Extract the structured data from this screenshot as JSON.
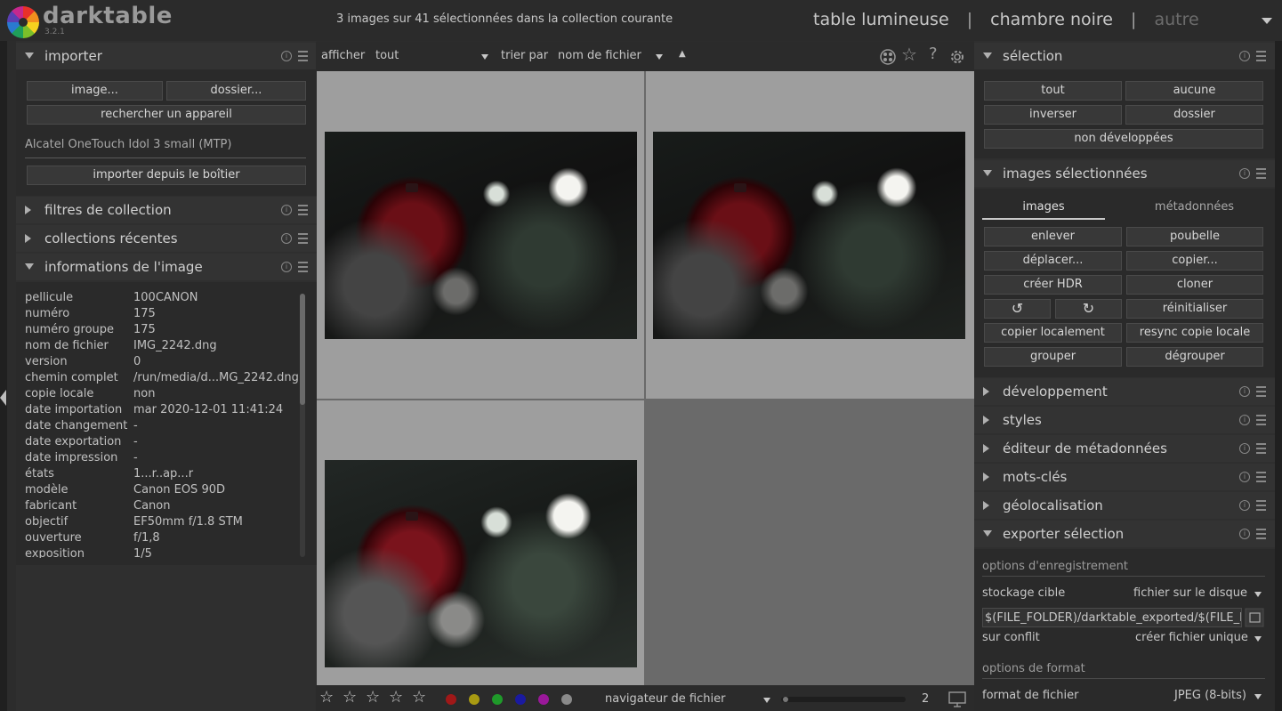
{
  "header": {
    "app_name": "darktable",
    "version": "3.2.1",
    "status": "3 images sur 41 sélectionnées dans la collection courante",
    "views": [
      "table lumineuse",
      "chambre noire",
      "autre"
    ],
    "separator": "|"
  },
  "left": {
    "importer": {
      "title": "importer",
      "buttons": {
        "image": "image...",
        "folder": "dossier...",
        "scan": "rechercher un appareil"
      },
      "device": "Alcatel OneTouch Idol 3 small (MTP)",
      "import_device": "importer depuis le boîtier"
    },
    "collection_filters": "filtres de collection",
    "recent_collections": "collections récentes",
    "image_info": {
      "title": "informations de l'image",
      "rows": [
        {
          "k": "pellicule",
          "v": "100CANON"
        },
        {
          "k": "numéro",
          "v": "175"
        },
        {
          "k": "numéro groupe",
          "v": "175"
        },
        {
          "k": "nom de fichier",
          "v": "IMG_2242.dng"
        },
        {
          "k": "version",
          "v": "0"
        },
        {
          "k": "chemin complet",
          "v": "/run/media/d...MG_2242.dng"
        },
        {
          "k": "copie locale",
          "v": "non"
        },
        {
          "k": "date importation",
          "v": "mar 2020-12-01 11:41:24"
        },
        {
          "k": "date changement",
          "v": "-"
        },
        {
          "k": "date exportation",
          "v": "-"
        },
        {
          "k": "date impression",
          "v": "-"
        },
        {
          "k": "états",
          "v": "1...r..ap...r"
        },
        {
          "k": "modèle",
          "v": "Canon EOS 90D"
        },
        {
          "k": "fabricant",
          "v": "Canon"
        },
        {
          "k": "objectif",
          "v": "EF50mm f/1.8 STM"
        },
        {
          "k": "ouverture",
          "v": "f/1,8"
        },
        {
          "k": "exposition",
          "v": "1/5"
        }
      ]
    }
  },
  "toolbar": {
    "show_label": "afficher",
    "show_value": "tout",
    "sort_label": "trier par",
    "sort_value": "nom de fichier",
    "sort_dir": "▲"
  },
  "bottombar": {
    "stars": [
      "☆",
      "☆",
      "☆",
      "☆",
      "☆"
    ],
    "color_labels": [
      "#a01818",
      "#a89a12",
      "#1f9a2a",
      "#1a1aa0",
      "#9a189a",
      "#8a8a8a"
    ],
    "layout": "navigateur de fichier",
    "zoom": "2"
  },
  "right": {
    "selection": {
      "title": "sélection",
      "buttons": [
        "tout",
        "aucune",
        "inverser",
        "dossier",
        "non développées"
      ]
    },
    "selected_images": {
      "title": "images sélectionnées",
      "tabs": [
        "images",
        "métadonnées"
      ],
      "buttons": [
        "enlever",
        "poubelle",
        "déplacer...",
        "copier...",
        "créer HDR",
        "cloner",
        "réinitialiser",
        "copier localement",
        "resync copie locale",
        "grouper",
        "dégrouper"
      ],
      "rotate_ccw": "↺",
      "rotate_cw": "↻"
    },
    "collapsed": [
      "développement",
      "styles",
      "éditeur de métadonnées",
      "mots-clés",
      "géolocalisation"
    ],
    "export": {
      "title": "exporter sélection",
      "storage_section": "options d'enregistrement",
      "target_label": "stockage cible",
      "target_value": "fichier sur le disque",
      "path": "$(FILE_FOLDER)/darktable_exported/$(FILE_NAME)",
      "conflict_label": "sur conflit",
      "conflict_value": "créer fichier unique",
      "format_section": "options de format",
      "format_label": "format de fichier",
      "format_value": "JPEG (8-bits)"
    }
  }
}
